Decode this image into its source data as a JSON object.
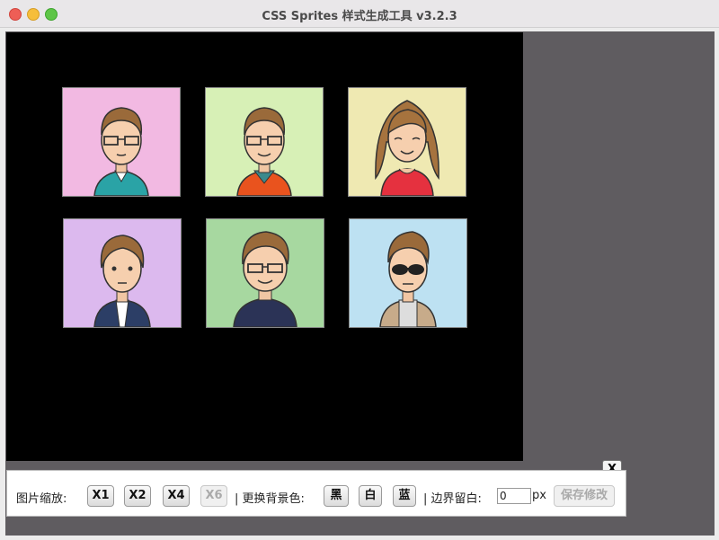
{
  "window": {
    "title": "CSS Sprites 样式生成工具 v3.2.3"
  },
  "sprites": [
    {
      "name": "avatar-man-teal-shirt",
      "bg": "#f2b9e2"
    },
    {
      "name": "avatar-man-orange-sweater",
      "bg": "#d7f0b6"
    },
    {
      "name": "avatar-woman-long-hair",
      "bg": "#efe9b2"
    },
    {
      "name": "avatar-man-suit",
      "bg": "#dcb9ee"
    },
    {
      "name": "avatar-man-dark-sweater",
      "bg": "#a7d8a0"
    },
    {
      "name": "avatar-man-sunglasses",
      "bg": "#bde1f2"
    }
  ],
  "toolbar": {
    "scale_label": "图片缩放:",
    "x1": "X1",
    "x2": "X2",
    "x4": "X4",
    "x6": "X6",
    "bg_label": "| 更换背景色:",
    "black": "黑",
    "white": "白",
    "blue": "蓝",
    "margin_label": "| 边界留白:",
    "margin_value": "0",
    "px": "px",
    "save": "保存修改",
    "close": "X"
  }
}
